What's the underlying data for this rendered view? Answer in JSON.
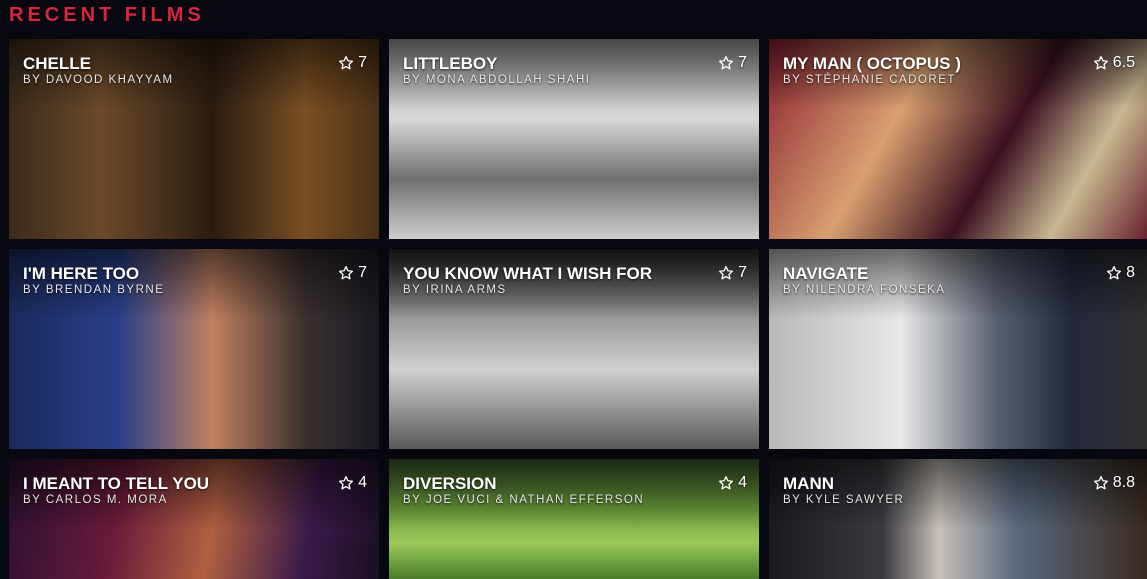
{
  "section": {
    "title": "RECENT FILMS"
  },
  "films": [
    {
      "title": "CHELLE",
      "byline": "BY DAVOOD KHAYYAM",
      "rating": "7"
    },
    {
      "title": "LITTLEBOY",
      "byline": "BY MONA ABDOLLAH SHAHI",
      "rating": "7"
    },
    {
      "title": "MY MAN ( OCTOPUS )",
      "byline": "BY STÉPHANIE CADORET",
      "rating": "6.5"
    },
    {
      "title": "I'M HERE TOO",
      "byline": "BY BRENDAN BYRNE",
      "rating": "7"
    },
    {
      "title": "YOU KNOW WHAT I WISH FOR",
      "byline": "BY IRINA ARMS",
      "rating": "7"
    },
    {
      "title": "NAVIGATE",
      "byline": "BY NILENDRA FONSEKA",
      "rating": "8"
    },
    {
      "title": "I MEANT TO TELL YOU",
      "byline": "BY CARLOS M. MORA",
      "rating": "4"
    },
    {
      "title": "DIVERSION",
      "byline": "BY JOE VUCI & NATHAN EFFERSON",
      "rating": "4"
    },
    {
      "title": "MANN",
      "byline": "BY KYLE SAWYER",
      "rating": "8.8"
    }
  ],
  "icons": {
    "rating": "star-outline-icon"
  },
  "colors": {
    "accent": "#d7263d",
    "background": "#07070f"
  }
}
